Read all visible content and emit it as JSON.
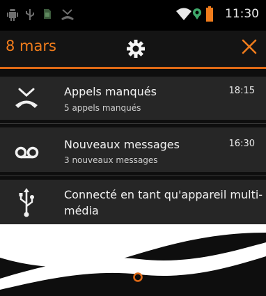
{
  "status_bar": {
    "time": "11:30",
    "icons": [
      "android-debug-icon",
      "usb-icon",
      "sim-card-icon",
      "missed-call-icon",
      "wifi-icon",
      "location-icon",
      "battery-icon"
    ]
  },
  "header": {
    "date": "8 mars",
    "settings_icon": "gear-icon",
    "close_icon": "close-icon"
  },
  "notifications": [
    {
      "icon": "missed-call-icon",
      "title": "Appels manqués",
      "subtitle": "5 appels manqués",
      "time": "18:15"
    },
    {
      "icon": "voicemail-icon",
      "title": "Nouveaux messages",
      "subtitle": "3  nouveaux messages",
      "time": "16:30"
    },
    {
      "icon": "usb-icon",
      "title_line1": "Connecté en tant qu'appareil multi-",
      "title_line2": "média"
    }
  ],
  "colors": {
    "accent": "#f07c1c",
    "background": "#0e0e0e",
    "panel": "#262626",
    "text": "#f2f2f2"
  }
}
